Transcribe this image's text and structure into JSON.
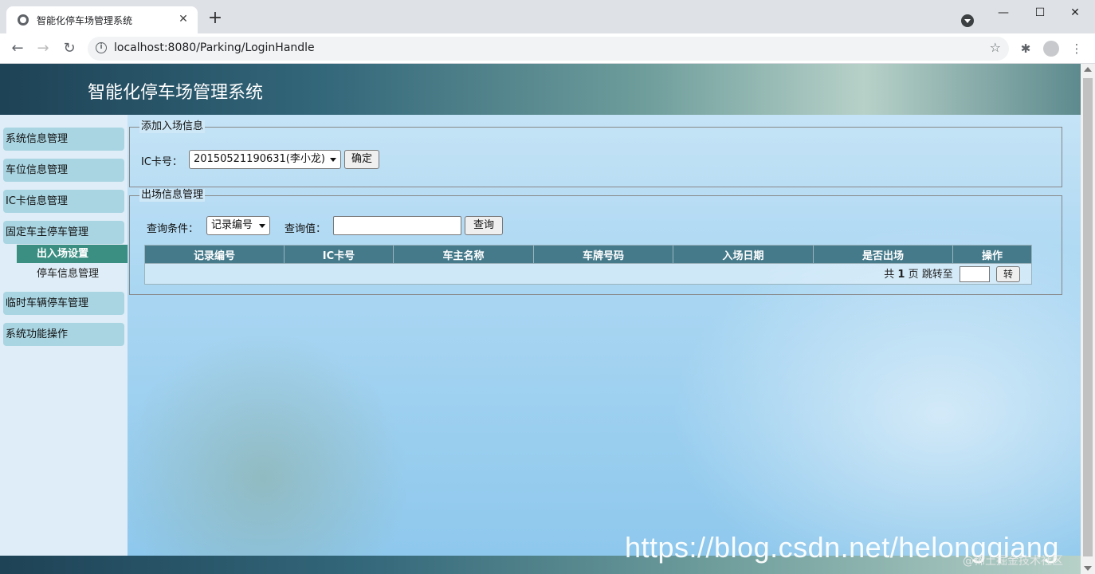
{
  "browser": {
    "tab_title": "智能化停车场管理系统",
    "tab_close": "✕",
    "new_tab": "+",
    "url": "localhost:8080/Parking/LoginHandle",
    "window_minimize": "—",
    "window_maximize": "☐",
    "window_close": "✕"
  },
  "banner": {
    "title": "智能化停车场管理系统"
  },
  "sidebar": {
    "items": [
      {
        "label": "系统信息管理"
      },
      {
        "label": "车位信息管理"
      },
      {
        "label": "IC卡信息管理"
      },
      {
        "label": "固定车主停车管理"
      },
      {
        "label": "临时车辆停车管理"
      },
      {
        "label": "系统功能操作"
      }
    ],
    "sub_items": [
      {
        "label": "出入场设置"
      },
      {
        "label": "停车信息管理"
      }
    ]
  },
  "entry_panel": {
    "legend": "添加入场信息",
    "ic_label": "IC卡号：",
    "ic_selected": "20150521190631(李小龙)",
    "confirm_label": "确定"
  },
  "exit_panel": {
    "legend": "出场信息管理",
    "query_condition_label": "查询条件：",
    "query_condition_selected": "记录编号",
    "query_value_label": "查询值：",
    "query_value": "",
    "query_button": "查询",
    "table": {
      "columns": [
        "记录编号",
        "IC卡号",
        "车主名称",
        "车牌号码",
        "入场日期",
        "是否出场",
        "操作"
      ],
      "rows": []
    },
    "pager": {
      "prefix": "共",
      "total_pages": "1",
      "suffix": "页 跳转至",
      "go_button": "转"
    }
  },
  "watermark": {
    "url_text": "https://blog.csdn.net/helongqiang",
    "community_text": "@稀土掘金技术社区"
  }
}
